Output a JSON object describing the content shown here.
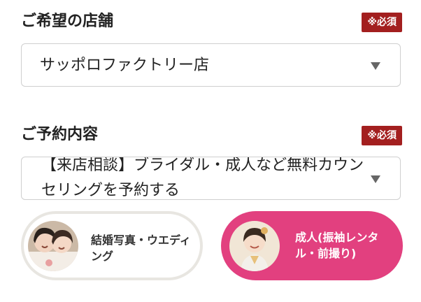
{
  "store_section": {
    "label": "ご希望の店舗",
    "badge": "※必須",
    "selected_store": "サッポロファクトリー店"
  },
  "reservation_section": {
    "label": "ご予約内容",
    "badge": "※必須",
    "selected_plan": "【来店相談】ブライダル・成人など無料カウンセリングを予約する"
  },
  "category_options": [
    {
      "label": "結婚写真・ウエディング",
      "selected": false
    },
    {
      "label": "成人(振袖レンタル・前撮り)",
      "selected": true
    }
  ],
  "colors": {
    "badge_bg": "#a31f1f",
    "selected_tile_bg": "#e2407f",
    "tile_border": "#e8e6e1"
  }
}
